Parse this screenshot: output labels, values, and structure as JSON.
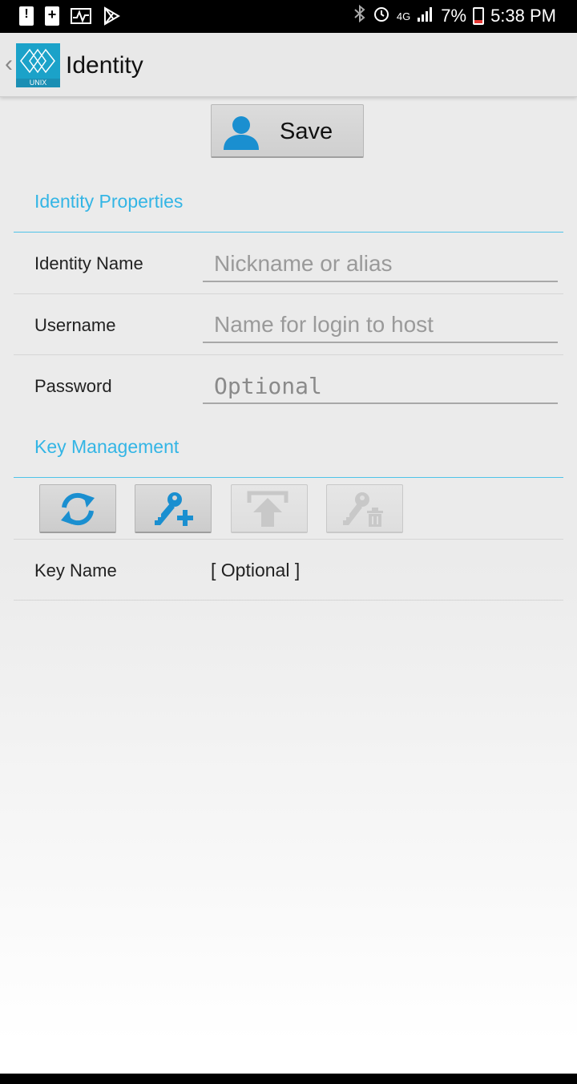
{
  "status_bar": {
    "network": "4G",
    "battery_percent": "7%",
    "time": "5:38 PM"
  },
  "action_bar": {
    "title": "Identity",
    "logo_caption": "UNIX"
  },
  "save_button": {
    "label": "Save"
  },
  "identity_properties": {
    "header": "Identity Properties",
    "fields": [
      {
        "label": "Identity Name",
        "placeholder": "Nickname or alias",
        "value": ""
      },
      {
        "label": "Username",
        "placeholder": "Name for login to host",
        "value": ""
      },
      {
        "label": "Password",
        "placeholder": "Optional",
        "value": ""
      }
    ]
  },
  "key_management": {
    "header": "Key Management",
    "buttons": [
      {
        "icon": "refresh-icon",
        "enabled": true
      },
      {
        "icon": "add-key-icon",
        "enabled": true
      },
      {
        "icon": "upload-icon",
        "enabled": false
      },
      {
        "icon": "delete-key-icon",
        "enabled": false
      }
    ],
    "key_name_label": "Key Name",
    "key_name_value": "[ Optional ]"
  },
  "colors": {
    "accent": "#33b5e5",
    "icon_blue": "#1a8fd0",
    "logo": "#1ba2c9"
  }
}
